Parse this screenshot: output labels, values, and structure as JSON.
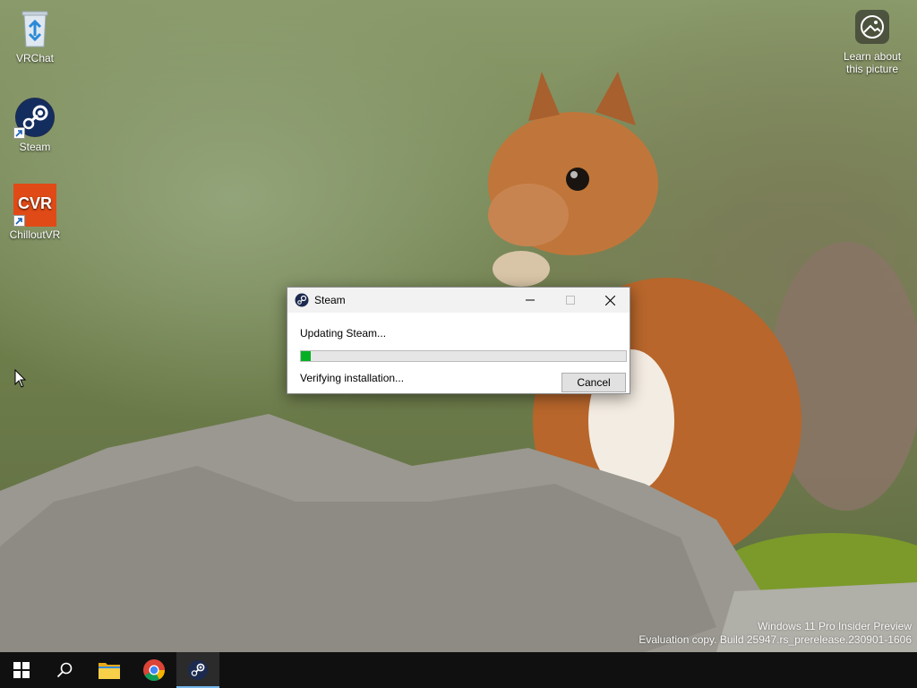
{
  "desktop": {
    "icons": [
      {
        "label": "VRChat",
        "icon": "recycle-bin-icon"
      },
      {
        "label": "Steam",
        "icon": "steam-icon"
      },
      {
        "label": "ChilloutVR",
        "icon": "chilloutvr-icon"
      }
    ],
    "learn_picture": {
      "line1": "Learn about",
      "line2": "this picture",
      "icon": "picture-info-icon"
    }
  },
  "dialog": {
    "title": "Steam",
    "status_primary": "Updating Steam...",
    "status_secondary": "Verifying installation...",
    "progress_fraction": 0.03,
    "cancel_label": "Cancel",
    "accent_color": "#06b025"
  },
  "watermark": {
    "line1": "Windows 11 Pro Insider Preview",
    "line2": "Evaluation copy. Build 25947.rs_prerelease.230901-1606"
  },
  "taskbar": {
    "items": [
      "start-icon",
      "search-icon",
      "file-explorer-icon",
      "chrome-icon",
      "steam-icon"
    ],
    "active_item": "steam-icon"
  },
  "colors": {
    "taskbar": "#101010",
    "progress": "#06b025",
    "active_underline": "#76b9ed"
  }
}
